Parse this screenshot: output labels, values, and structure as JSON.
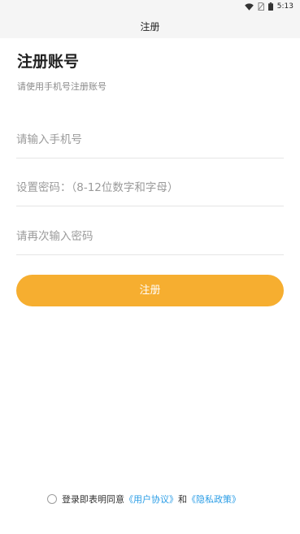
{
  "status_bar": {
    "time": "5:13",
    "icons": [
      "wifi-icon",
      "no-sim-icon",
      "battery-icon"
    ]
  },
  "nav": {
    "title": "注册"
  },
  "header": {
    "title": "注册账号",
    "subtitle": "请使用手机号注册账号"
  },
  "form": {
    "phone_placeholder": "请输入手机号",
    "phone_value": "",
    "password_placeholder": "设置密码：（8-12位数字和字母）",
    "password_value": "",
    "confirm_placeholder": "请再次输入密码",
    "confirm_value": "",
    "submit_label": "注册"
  },
  "agreement": {
    "checked": false,
    "prefix": "登录即表明同意",
    "user_agreement": "《用户协议》",
    "and": "和",
    "privacy_policy": "《隐私政策》"
  },
  "colors": {
    "accent": "#f6ae30",
    "link": "#2a9de6",
    "background": "#ffffff",
    "bar": "#f5f5f5"
  }
}
